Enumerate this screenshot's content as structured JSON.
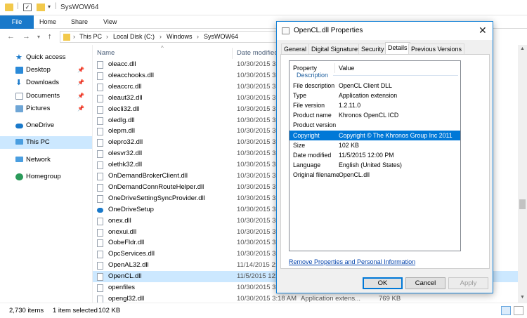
{
  "window": {
    "title": "SysWOW64"
  },
  "ribbon": {
    "tabs": [
      "File",
      "Home",
      "Share",
      "View"
    ]
  },
  "address": {
    "segments": [
      "This PC",
      "Local Disk (C:)",
      "Windows",
      "SysWOW64"
    ]
  },
  "nav_pane": {
    "items": [
      {
        "label": "Quick access",
        "icon": "star-icon",
        "pinned": false
      },
      {
        "label": "Desktop",
        "icon": "desktop-icon",
        "pinned": true
      },
      {
        "label": "Downloads",
        "icon": "download-icon",
        "pinned": true
      },
      {
        "label": "Documents",
        "icon": "documents-icon",
        "pinned": true
      },
      {
        "label": "Pictures",
        "icon": "pictures-icon",
        "pinned": true
      },
      {
        "label": "OneDrive",
        "icon": "onedrive-icon",
        "pinned": false
      },
      {
        "label": "This PC",
        "icon": "computer-icon",
        "pinned": false,
        "selected": true
      },
      {
        "label": "Network",
        "icon": "network-icon",
        "pinned": false
      },
      {
        "label": "Homegroup",
        "icon": "homegroup-icon",
        "pinned": false
      }
    ]
  },
  "file_list": {
    "columns": {
      "name": "Name",
      "date_modified": "Date modified"
    },
    "rows": [
      {
        "name": "oleacc.dll",
        "date": "10/30/2015 3:1",
        "type": "",
        "size": ""
      },
      {
        "name": "oleacchooks.dll",
        "date": "10/30/2015 3:1",
        "type": "",
        "size": ""
      },
      {
        "name": "oleaccrc.dll",
        "date": "10/30/2015 3:1",
        "type": "",
        "size": ""
      },
      {
        "name": "oleaut32.dll",
        "date": "10/30/2015 3:1",
        "type": "",
        "size": ""
      },
      {
        "name": "olecli32.dll",
        "date": "10/30/2015 3:1",
        "type": "",
        "size": ""
      },
      {
        "name": "oledlg.dll",
        "date": "10/30/2015 3:1",
        "type": "",
        "size": ""
      },
      {
        "name": "olepm.dll",
        "date": "10/30/2015 3:1",
        "type": "",
        "size": ""
      },
      {
        "name": "olepro32.dll",
        "date": "10/30/2015 3:1",
        "type": "",
        "size": ""
      },
      {
        "name": "olesvr32.dll",
        "date": "10/30/2015 3:1",
        "type": "",
        "size": ""
      },
      {
        "name": "olethk32.dll",
        "date": "10/30/2015 3:1",
        "type": "",
        "size": ""
      },
      {
        "name": "OnDemandBrokerClient.dll",
        "date": "10/30/2015 3:1",
        "type": "",
        "size": ""
      },
      {
        "name": "OnDemandConnRouteHelper.dll",
        "date": "10/30/2015 3:1",
        "type": "",
        "size": ""
      },
      {
        "name": "OneDriveSettingSyncProvider.dll",
        "date": "10/30/2015 3:1",
        "type": "",
        "size": ""
      },
      {
        "name": "OneDriveSetup",
        "date": "10/30/2015 3:1",
        "type": "",
        "size": "",
        "icon": "onedrive-icon"
      },
      {
        "name": "onex.dll",
        "date": "10/30/2015 3:1",
        "type": "",
        "size": ""
      },
      {
        "name": "onexui.dll",
        "date": "10/30/2015 3:1",
        "type": "",
        "size": ""
      },
      {
        "name": "OobeFldr.dll",
        "date": "10/30/2015 3:1",
        "type": "",
        "size": ""
      },
      {
        "name": "OpcServices.dll",
        "date": "10/30/2015 3:1",
        "type": "",
        "size": ""
      },
      {
        "name": "OpenAL32.dll",
        "date": "11/14/2015 2:4",
        "type": "",
        "size": ""
      },
      {
        "name": "OpenCL.dll",
        "date": "11/5/2015 12:0",
        "type": "",
        "size": "",
        "selected": true
      },
      {
        "name": "openfiles",
        "date": "10/30/2015 3:1",
        "type": "",
        "size": ""
      },
      {
        "name": "opengl32.dll",
        "date": "10/30/2015 3:18 AM",
        "type": "Application extens...",
        "size": "769 KB"
      }
    ]
  },
  "status_bar": {
    "items_count": "2,730 items",
    "selection": "1 item selected",
    "selection_size": "102 KB"
  },
  "dialog": {
    "title": "OpenCL.dll Properties",
    "tabs": [
      "General",
      "Digital Signatures",
      "Security",
      "Details",
      "Previous Versions"
    ],
    "active_tab": "Details",
    "header": {
      "property": "Property",
      "value": "Value"
    },
    "group_label": "Description",
    "rows": [
      {
        "property": "File description",
        "value": "OpenCL Client DLL"
      },
      {
        "property": "Type",
        "value": "Application extension"
      },
      {
        "property": "File version",
        "value": "1.2.11.0"
      },
      {
        "property": "Product name",
        "value": "Khronos OpenCL ICD"
      },
      {
        "property": "Product version",
        "value": ""
      },
      {
        "property": "Copyright",
        "value": "Copyright © The Khronos Group Inc 2011",
        "selected": true
      },
      {
        "property": "Size",
        "value": "102 KB"
      },
      {
        "property": "Date modified",
        "value": "11/5/2015 12:00 PM"
      },
      {
        "property": "Language",
        "value": "English (United States)"
      },
      {
        "property": "Original filename",
        "value": "OpenCL.dll"
      }
    ],
    "remove_link": "Remove Properties and Personal Information",
    "buttons": {
      "ok": "OK",
      "cancel": "Cancel",
      "apply": "Apply"
    }
  },
  "colors": {
    "accent": "#1979ca",
    "selection": "#cce8ff",
    "dialog_selection": "#0078d7",
    "folder": "#f2c94c"
  }
}
